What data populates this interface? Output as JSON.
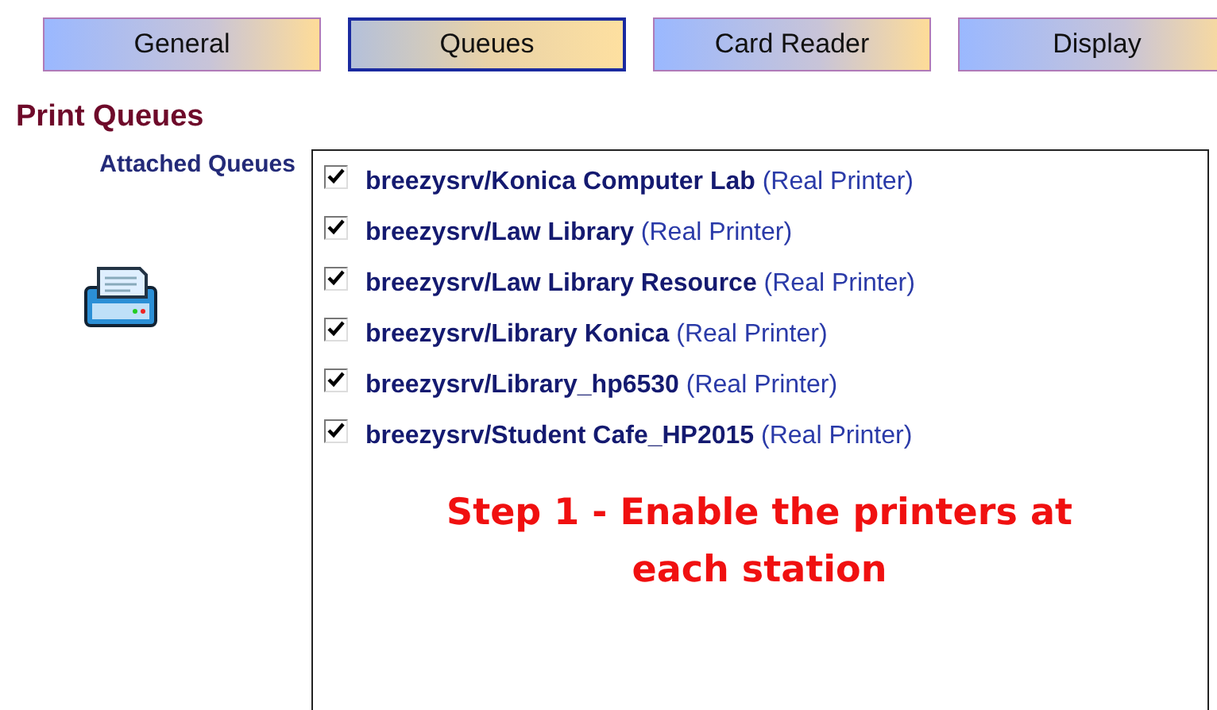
{
  "tabs": [
    {
      "label": "General",
      "selected": false
    },
    {
      "label": "Queues",
      "selected": true
    },
    {
      "label": "Card Reader",
      "selected": false
    },
    {
      "label": "Display",
      "selected": false
    }
  ],
  "section_title": "Print Queues",
  "attached_queues": {
    "label": "Attached Queues",
    "items": [
      {
        "text": "**breezysrv/Konica Computer Lab** (Real Printer)",
        "checked": true
      },
      {
        "text": "**breezysrv/Law Library** (Real Printer)",
        "checked": true
      },
      {
        "text": "**breezysrv/Law Library Resource** (Real Printer)",
        "checked": true
      },
      {
        "text": "**breezysrv/Library Konica** (Real Printer)",
        "checked": true
      },
      {
        "text": "**breezysrv/Library_hp6530** (Real Printer)",
        "checked": true
      },
      {
        "text": "**breezysrv/Student Cafe_HP2015** (Real Printer)",
        "checked": true
      }
    ],
    "note": "Step 1 - Enable the printers at each station"
  }
}
